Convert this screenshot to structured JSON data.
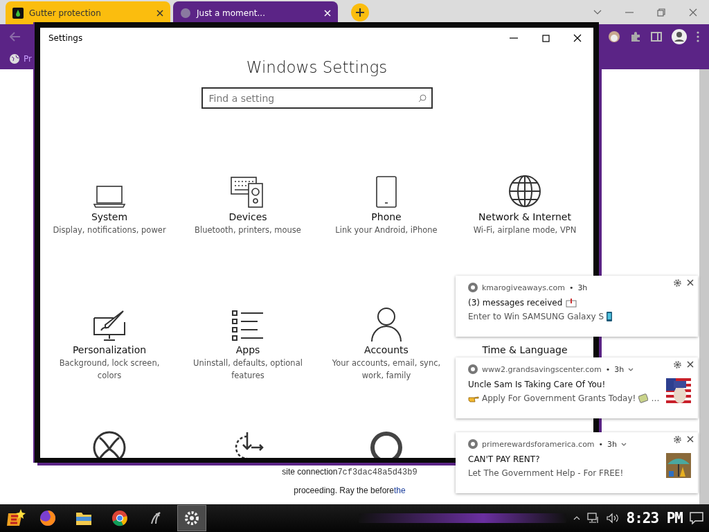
{
  "browser": {
    "tabs": [
      {
        "title": "Gutter protection",
        "selected": false
      },
      {
        "title": "Just a moment...",
        "selected": true
      }
    ],
    "bookmarks": [
      {
        "label": "Pr"
      }
    ],
    "page": {
      "lines": [
        {
          "segments": [
            {
              "kind": "text",
              "text": "site connection"
            },
            {
              "kind": "mono",
              "text": "7cf3dac48a5d43b9"
            }
          ]
        },
        {
          "segments": [
            {
              "kind": "text",
              "text": "proceeding. Ray the before"
            },
            {
              "kind": "link",
              "text": "the"
            }
          ]
        }
      ]
    }
  },
  "settings_window": {
    "title": "Settings",
    "heading": "Windows Settings",
    "search": {
      "placeholder": "Find a setting"
    },
    "items": [
      {
        "title": "System",
        "description": "Display, notifications, power"
      },
      {
        "title": "Devices",
        "description": "Bluetooth, printers, mouse"
      },
      {
        "title": "Phone",
        "description": "Link your Android, iPhone"
      },
      {
        "title": "Network & Internet",
        "description": "Wi-Fi, airplane mode, VPN"
      },
      {
        "title": "Personalization",
        "description": "Background, lock screen, colors"
      },
      {
        "title": "Apps",
        "description": "Uninstall, defaults, optional features"
      },
      {
        "title": "Accounts",
        "description": "Your accounts, email, sync, work, family"
      },
      {
        "title": "Time & Language"
      }
    ]
  },
  "notifications": [
    {
      "site": "kmarogiveaways.com",
      "separator": "•",
      "age": "3h",
      "expandable": false,
      "title": "(3) messages received",
      "body": "Enter to Win SAMSUNG Galaxy S"
    },
    {
      "site": "www2.grandsavingscenter.com",
      "separator": "•",
      "age": "3h",
      "expandable": true,
      "title": "Uncle Sam Is Taking Care Of You!",
      "body": "Apply For Government Grants Today!",
      "ellipsis": "…"
    },
    {
      "site": "primerewardsforamerica.com",
      "separator": "•",
      "age": "3h",
      "expandable": true,
      "title": "CAN'T PAY RENT?",
      "body": "Let The Government Help - For FREE!"
    }
  ],
  "taskbar": {
    "apps": [
      {
        "selected": false
      },
      {
        "selected": false
      },
      {
        "selected": false
      },
      {
        "selected": false
      },
      {
        "selected": true
      }
    ],
    "clock": "8:23 PM"
  }
}
